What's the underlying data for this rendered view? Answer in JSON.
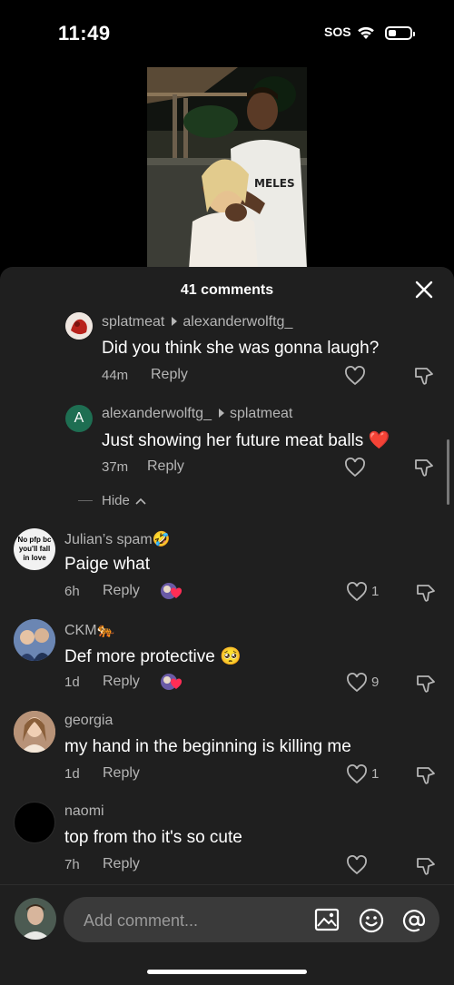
{
  "status_bar": {
    "time": "11:49",
    "sos": "SOS"
  },
  "sheet": {
    "title": "41 comments"
  },
  "comments": [
    {
      "user": "splatmeat",
      "reply_to": "alexanderwolftg_",
      "text": "Did you think she was gonna laugh?",
      "time": "44m",
      "reply": "Reply",
      "likes": ""
    },
    {
      "user": "alexanderwolftg_",
      "reply_to": "splatmeat",
      "avatar_letter": "A",
      "text": "Just showing her future meat balls",
      "emoji": "❤️",
      "time": "37m",
      "reply": "Reply",
      "likes": ""
    },
    {
      "user": "Julian’s spam",
      "user_emoji": "🤣",
      "avatar_text": "No pfp bc you'll fall in love",
      "text": "Paige what",
      "time": "6h",
      "reply": "Reply",
      "likes": "1"
    },
    {
      "user": "CKM",
      "user_emoji": "🐅",
      "text": "Def more protective",
      "emoji": "🥺",
      "time": "1d",
      "reply": "Reply",
      "likes": "9"
    },
    {
      "user": "georgia",
      "text": "my hand in the beginning is killing me",
      "time": "1d",
      "reply": "Reply",
      "likes": "1"
    },
    {
      "user": "naomi",
      "text": "top from tho it's so cute",
      "time": "7h",
      "reply": "Reply",
      "likes": ""
    }
  ],
  "hide_label": "Hide",
  "input": {
    "placeholder": "Add comment..."
  },
  "colors": {
    "sheet_bg": "#1f1f1f",
    "input_bg": "#3a3a3a",
    "secondary_text": "#b5b5b5",
    "heart_red": "#ff2d55",
    "avatar_green": "#1e6e52"
  },
  "icons": [
    "wifi-icon",
    "battery-icon",
    "close-icon",
    "heart-outline-icon",
    "dislike-icon",
    "chevron-up-icon",
    "image-icon",
    "emoji-icon",
    "mention-icon"
  ]
}
